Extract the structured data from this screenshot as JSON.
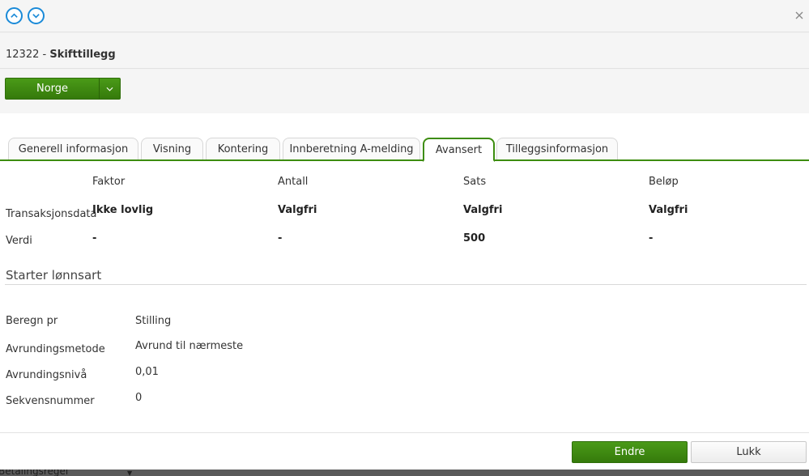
{
  "window": {
    "close_glyph": "×"
  },
  "header": {
    "id": "12322",
    "separator": " - ",
    "name": "Skifttillegg"
  },
  "country_button": {
    "label": "Norge"
  },
  "tabs": [
    {
      "label": "Generell informasjon",
      "active": false
    },
    {
      "label": "Visning",
      "active": false
    },
    {
      "label": "Kontering",
      "active": false
    },
    {
      "label": "Innberetning A-melding",
      "active": false
    },
    {
      "label": "Avansert",
      "active": true
    },
    {
      "label": "Tilleggsinformasjon",
      "active": false
    }
  ],
  "grid": {
    "columns": [
      "Faktor",
      "Antall",
      "Sats",
      "Beløp"
    ],
    "rows": [
      {
        "label": "Transaksjonsdata",
        "values": [
          "Ikke lovlig",
          "Valgfri",
          "Valgfri",
          "Valgfri"
        ]
      },
      {
        "label": "Verdi",
        "values": [
          "-",
          "-",
          "500",
          "-"
        ]
      }
    ]
  },
  "section_title": "Starter lønnsart",
  "fields": [
    {
      "label": "Beregn pr",
      "value": "Stilling"
    },
    {
      "label": "Avrundingsmetode",
      "value": "Avrund til nærmeste"
    },
    {
      "label": "Avrundingsnivå",
      "value": "0,01"
    },
    {
      "label": "Sekvensnummer",
      "value": "0"
    }
  ],
  "footer": {
    "edit_label": "Endre",
    "close_label": "Lukk"
  },
  "underlay": {
    "text": "Betalingsregel"
  },
  "colors": {
    "primary_green": "#3d8d10",
    "nav_blue": "#1a8ad8"
  }
}
